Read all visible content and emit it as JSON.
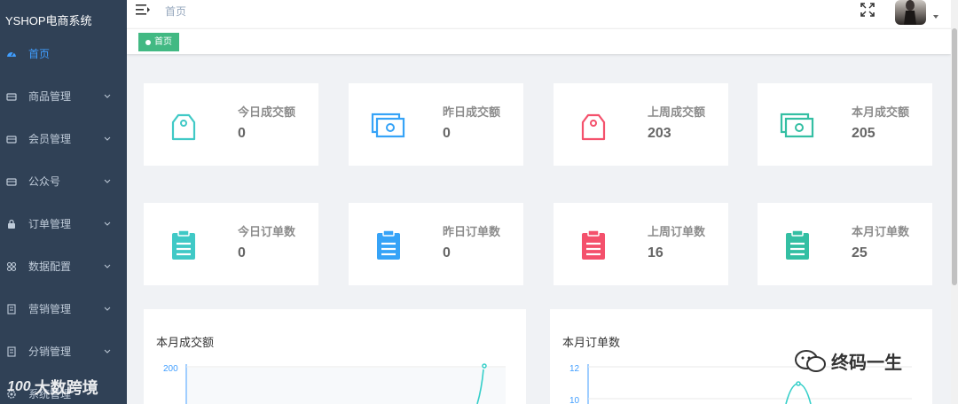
{
  "brand": "YSHOP电商系统",
  "menu": [
    {
      "label": "首页",
      "icon": "dashboard-icon",
      "active": true,
      "chevron": false
    },
    {
      "label": "商品管理",
      "icon": "box-icon",
      "active": false,
      "chevron": true
    },
    {
      "label": "会员管理",
      "icon": "box-icon",
      "active": false,
      "chevron": true
    },
    {
      "label": "公众号",
      "icon": "box-icon",
      "active": false,
      "chevron": true
    },
    {
      "label": "订单管理",
      "icon": "lock-icon",
      "active": false,
      "chevron": true
    },
    {
      "label": "数据配置",
      "icon": "grid-icon",
      "active": false,
      "chevron": true
    },
    {
      "label": "营销管理",
      "icon": "document-icon",
      "active": false,
      "chevron": true
    },
    {
      "label": "分销管理",
      "icon": "document-icon",
      "active": false,
      "chevron": true
    },
    {
      "label": "系统管理",
      "icon": "gear-icon",
      "active": false,
      "chevron": false
    }
  ],
  "header": {
    "breadcrumb": "首页"
  },
  "tags": [
    {
      "label": "首页"
    }
  ],
  "cards_row1": [
    {
      "label": "今日成交额",
      "value": "0",
      "icon": "price-tag-icon",
      "color": "#40c9c6"
    },
    {
      "label": "昨日成交额",
      "value": "0",
      "icon": "money-icon",
      "color": "#36a3f7"
    },
    {
      "label": "上周成交额",
      "value": "203",
      "icon": "price-tag-icon",
      "color": "#f4516c"
    },
    {
      "label": "本月成交额",
      "value": "205",
      "icon": "money-icon",
      "color": "#34bfa3"
    }
  ],
  "cards_row2": [
    {
      "label": "今日订单数",
      "value": "0",
      "icon": "clipboard-icon",
      "color": "#40c9c6"
    },
    {
      "label": "昨日订单数",
      "value": "0",
      "icon": "clipboard-icon",
      "color": "#36a3f7"
    },
    {
      "label": "上周订单数",
      "value": "16",
      "icon": "clipboard-icon",
      "color": "#f4516c"
    },
    {
      "label": "本月订单数",
      "value": "25",
      "icon": "clipboard-icon",
      "color": "#34bfa3"
    }
  ],
  "panels": [
    {
      "title": "本月成交额",
      "y_tick_top": "200"
    },
    {
      "title": "本月订单数",
      "y_tick_top": "12",
      "y_tick_second": "10"
    }
  ],
  "watermarks": {
    "left": "大数跨境",
    "left_logo": "100",
    "right": "终码一生"
  }
}
